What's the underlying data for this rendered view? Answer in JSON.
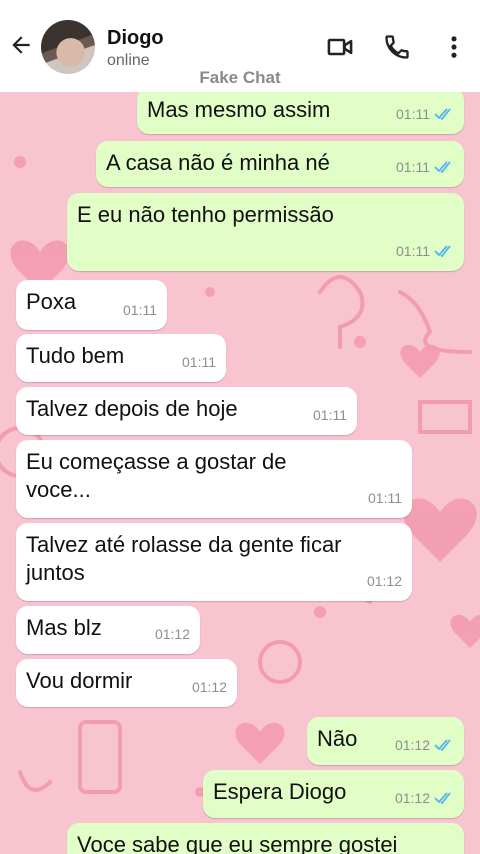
{
  "header": {
    "contact_name": "Diogo",
    "contact_status": "online",
    "watermark": "Fake Chat",
    "icons": [
      "back-arrow-icon",
      "video-call-icon",
      "phone-icon",
      "more-vert-icon"
    ]
  },
  "colors": {
    "wallpaper": "#f8c4d0",
    "outgoing_bubble": "#e1fec7",
    "incoming_bubble": "#ffffff",
    "read_ticks": "#4fb6ec"
  },
  "messages": [
    {
      "dir": "out",
      "text": "Mas mesmo assim",
      "time": "01:11",
      "read": true
    },
    {
      "dir": "out",
      "text": "A casa não é minha né",
      "time": "01:11",
      "read": true
    },
    {
      "dir": "out",
      "text": "E eu não tenho permissão",
      "time": "01:11",
      "read": true
    },
    {
      "dir": "in",
      "text": "Poxa",
      "time": "01:11"
    },
    {
      "dir": "in",
      "text": "Tudo bem",
      "time": "01:11"
    },
    {
      "dir": "in",
      "text": "Talvez depois de hoje",
      "time": "01:11"
    },
    {
      "dir": "in",
      "text": "Eu começasse a gostar de\nvoce...",
      "time": "01:11"
    },
    {
      "dir": "in",
      "text": "Talvez até rolasse da gente ficar\njuntos",
      "time": "01:12"
    },
    {
      "dir": "in",
      "text": "Mas blz",
      "time": "01:12"
    },
    {
      "dir": "in",
      "text": "Vou dormir",
      "time": "01:12"
    },
    {
      "dir": "out",
      "text": "Não",
      "time": "01:12",
      "read": true
    },
    {
      "dir": "out",
      "text": "Espera Diogo",
      "time": "01:12",
      "read": true
    },
    {
      "dir": "out",
      "text": "Voce sabe que eu sempre gostei",
      "time": "",
      "read": false
    }
  ]
}
